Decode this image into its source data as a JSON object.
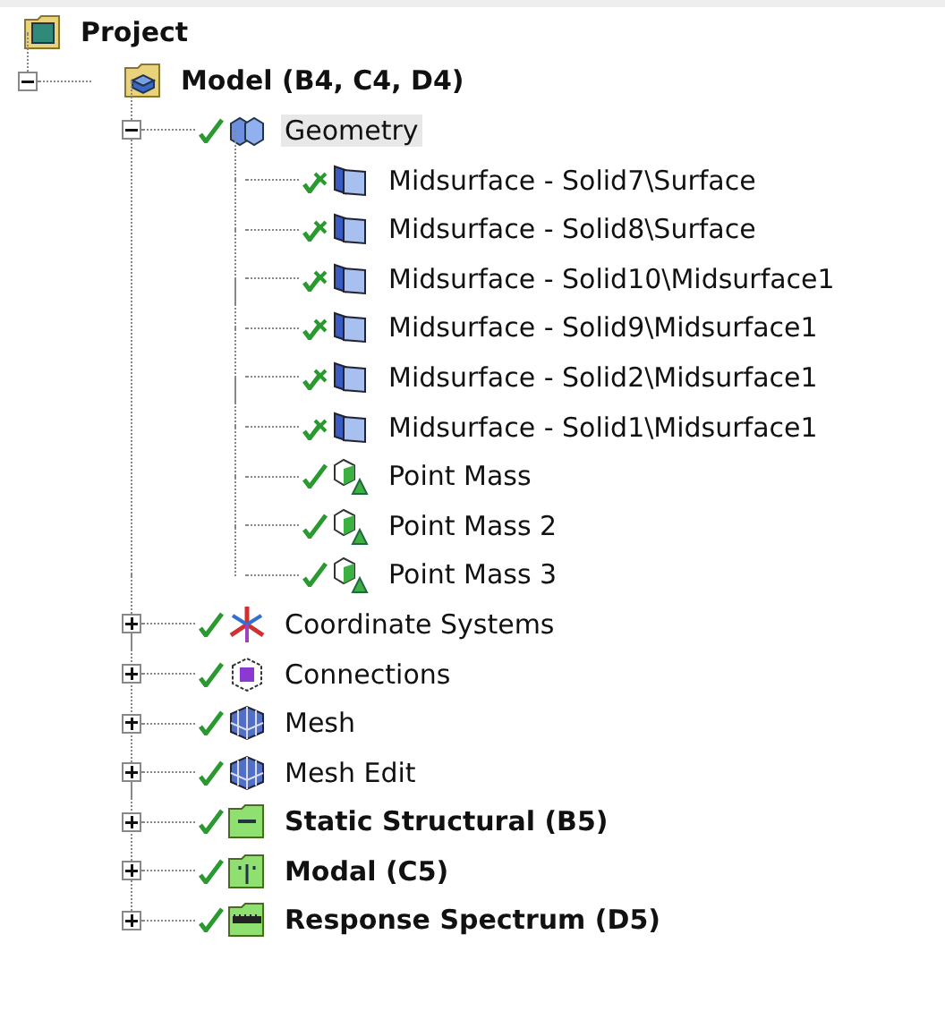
{
  "tree": {
    "label": "Project",
    "kind": "project",
    "bold": true,
    "selected": false,
    "children": [
      {
        "label": "Model (B4, C4, D4)",
        "kind": "model",
        "bold": true,
        "selected": false,
        "expanded": true,
        "children": [
          {
            "label": "Geometry",
            "kind": "geometry",
            "flagged": false,
            "bold": false,
            "selected": true,
            "expanded": true,
            "children": [
              {
                "label": "Midsurface - Solid7\\Surface",
                "kind": "surface",
                "flagged": true,
                "bold": false,
                "selected": false
              },
              {
                "label": "Midsurface - Solid8\\Surface",
                "kind": "surface",
                "flagged": true,
                "bold": false,
                "selected": false
              },
              {
                "label": "Midsurface - Solid10\\Midsurface1",
                "kind": "surface",
                "flagged": true,
                "bold": false,
                "selected": false
              },
              {
                "label": "Midsurface - Solid9\\Midsurface1",
                "kind": "surface",
                "flagged": true,
                "bold": false,
                "selected": false
              },
              {
                "label": "Midsurface - Solid2\\Midsurface1",
                "kind": "surface",
                "flagged": true,
                "bold": false,
                "selected": false
              },
              {
                "label": "Midsurface - Solid1\\Midsurface1",
                "kind": "surface",
                "flagged": true,
                "bold": false,
                "selected": false
              },
              {
                "label": "Point Mass",
                "kind": "point-mass",
                "flagged": false,
                "bold": false,
                "selected": false
              },
              {
                "label": "Point Mass 2",
                "kind": "point-mass",
                "flagged": false,
                "bold": false,
                "selected": false
              },
              {
                "label": "Point Mass 3",
                "kind": "point-mass",
                "flagged": false,
                "bold": false,
                "selected": false
              }
            ]
          },
          {
            "label": "Coordinate Systems",
            "kind": "coordinates",
            "flagged": false,
            "bold": false,
            "selected": false,
            "expanded": false
          },
          {
            "label": "Connections",
            "kind": "connections",
            "flagged": false,
            "bold": false,
            "selected": false,
            "expanded": false
          },
          {
            "label": "Mesh",
            "kind": "mesh",
            "flagged": false,
            "bold": false,
            "selected": false,
            "expanded": false
          },
          {
            "label": "Mesh Edit",
            "kind": "mesh",
            "flagged": false,
            "bold": false,
            "selected": false,
            "expanded": false
          },
          {
            "label": "Static Structural (B5)",
            "kind": "static",
            "flagged": false,
            "bold": true,
            "selected": false,
            "expanded": false
          },
          {
            "label": "Modal (C5)",
            "kind": "modal",
            "flagged": false,
            "bold": true,
            "selected": false,
            "expanded": false
          },
          {
            "label": "Response Spectrum (D5)",
            "kind": "spectrum",
            "flagged": false,
            "bold": true,
            "selected": false,
            "expanded": false
          }
        ]
      }
    ]
  }
}
